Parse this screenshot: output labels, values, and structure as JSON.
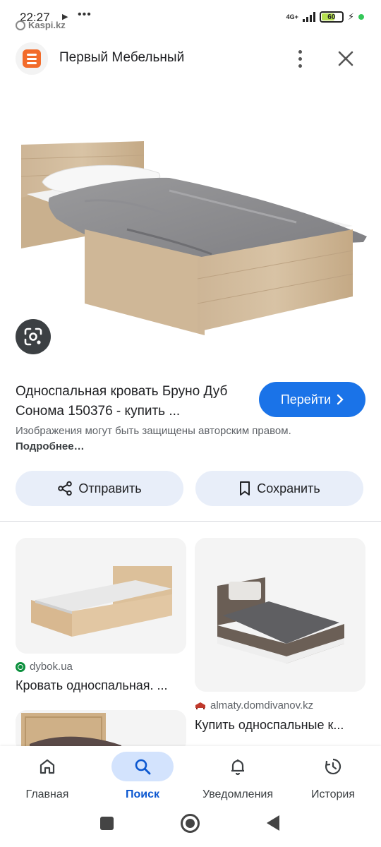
{
  "status_bar": {
    "time": "22:27",
    "source": "Kaspi.kz",
    "network": "4G+",
    "battery": "60"
  },
  "header": {
    "site_title": "Первый Мебельный"
  },
  "result": {
    "title": "Односпальная кровать Бруно Дуб Сонома 150376 - купить ...",
    "go_button": "Перейти",
    "copyright_text": "Изображения могут быть защищены авторским правом.",
    "copyright_link": "Подробнее…"
  },
  "actions": {
    "send_label": "Отправить",
    "save_label": "Сохранить"
  },
  "related": [
    {
      "source": "dybok.ua",
      "title": "Кровать односпальная. ..."
    },
    {
      "source": "almaty.domdivanov.kz",
      "title": "Купить односпальные к..."
    }
  ],
  "bottom_nav": {
    "home": "Главная",
    "search": "Поиск",
    "notifications": "Уведомления",
    "history": "История"
  },
  "colors": {
    "accent": "#1a73e8",
    "action_bg": "#e8eef9",
    "active_nav_bg": "#d3e3fd",
    "site_logo": "#f26b2a"
  },
  "icons": {
    "lens": "google-lens-icon",
    "share": "share-icon",
    "bookmark": "bookmark-icon",
    "home": "home-icon",
    "search": "search-icon",
    "bell": "bell-icon",
    "history": "history-icon"
  }
}
